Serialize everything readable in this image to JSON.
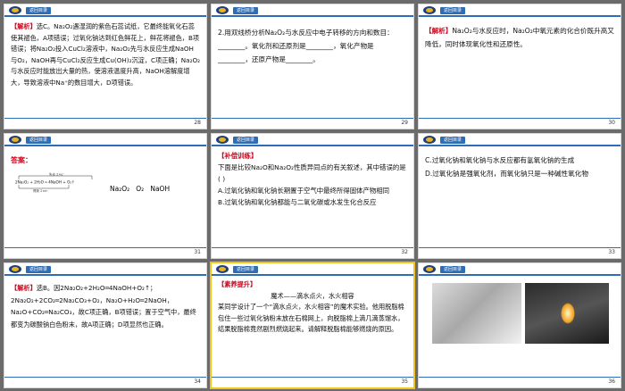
{
  "back_label": "返回目录",
  "slides": [
    {
      "page": "28",
      "label": "【解析】",
      "text": "选C。Na₂O₂遇湿润的紫色石蕊试纸，它最终能氧化石蕊使其褪色，A项错误；过氧化钠达到红色鲜花上，鲜花将褪色，B项错误；将Na₂O₂投入CuCl₂溶液中，Na₂O₂先与水反应生成NaOH与O₂，NaOH再与CuCl₂反应生成Cu(OH)₂沉淀，C项正确；Na₂O₂与水反应时能放出大量的热，使溶液温度升高，NaOH溶解度增大，导致溶液中Na⁺的数目增大，D项错误。"
    },
    {
      "page": "29",
      "label": "",
      "text": "2.用双线桥分析Na₂O₂与水反应中电子转移的方向和数目：________。氧化剂和还原剂是________，氧化产物是________，还原产物是________。"
    },
    {
      "page": "30",
      "label": "【解析】",
      "text": "Na₂O₂与水反应时，Na₂O₂中氧元素的化合价既升高又降低，同时体现氧化性和还原性。"
    },
    {
      "page": "31",
      "label": "答案：",
      "eq_top": "失去 2×e⁻",
      "eq_mid": "2Na₂O₂ + 2H₂O ═ 4NaOH + O₂↑",
      "eq_bot": "得到 2×e⁻",
      "answer": "Na₂O₂   O₂   NaOH"
    },
    {
      "page": "32",
      "label": "【补偿训练】",
      "text": "下面是比较Na₂O和Na₂O₂性质异同点的有关叙述，其中错误的是  (    )",
      "opt_a": "A.过氧化钠和氧化钠长期置于空气中最终所得固体产物相同",
      "opt_b": "B.过氧化钠和氧化钠都能与二氧化碳或水发生化合反应"
    },
    {
      "page": "33",
      "label": "",
      "opt_c": "C.过氧化钠和氧化钠与水反应都有氢氧化钠的生成",
      "opt_d": "D.过氧化钠是强氧化剂，而氧化钠只是一种碱性氧化物"
    },
    {
      "page": "34",
      "label": "【解析】",
      "text": "选B。因2Na₂O₂+2H₂O═4NaOH+O₂↑；2Na₂O₂+2CO₂═2Na₂CO₃+O₂，Na₂O+H₂O═2NaOH，Na₂O+CO₂═Na₂CO₃，故C项正确，B项错误；置于空气中，最终都变为碳酸钠白色粉末，故A项正确；D项显然也正确。"
    },
    {
      "page": "35",
      "label": "【素养提升】",
      "title": "魔术——滴水点火，水火相容",
      "text": "某同学设计了一个“滴水点火，水火相容”的魔术实验。他用脱脂棉包住一些过氧化钠粉末放在石棉网上，向脱脂棉上滴几滴蒸馏水，结果脱脂棉竟然剧烈燃烧起来。请解释脱脂棉能够燃烧的原因。"
    },
    {
      "page": "36",
      "label": ""
    }
  ]
}
